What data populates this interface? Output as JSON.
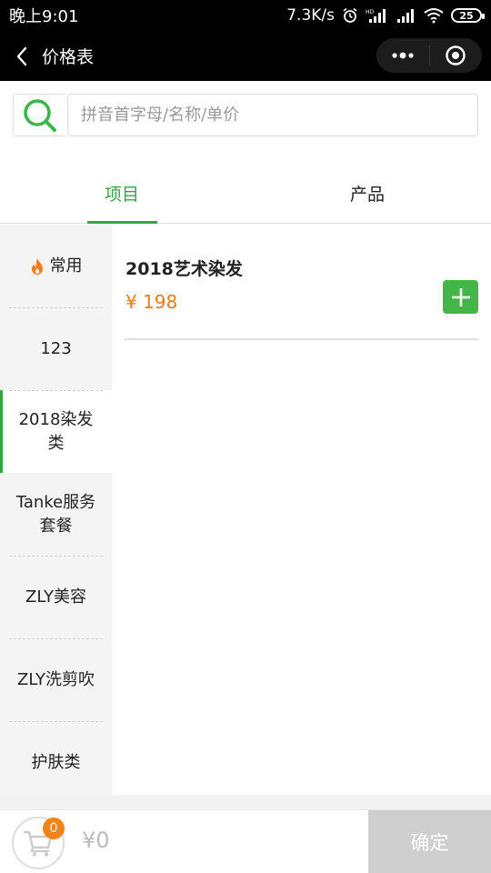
{
  "status_bar": {
    "time": "晚上9:01",
    "network_speed": "7.3K/s",
    "battery": "25",
    "hd_label": "HD"
  },
  "nav": {
    "title": "价格表"
  },
  "search": {
    "placeholder": "拼音首字母/名称/单价",
    "value": ""
  },
  "tabs": [
    {
      "label": "项目",
      "active": true
    },
    {
      "label": "产品",
      "active": false
    }
  ],
  "sidebar": {
    "items": [
      {
        "label": "常用",
        "icon": "fire-icon"
      },
      {
        "label": "123"
      },
      {
        "label": "2018染发类",
        "active": true
      },
      {
        "label": "Tanke服务套餐"
      },
      {
        "label": "ZLY美容"
      },
      {
        "label": "ZLY洗剪吹"
      },
      {
        "label": "护肤类"
      }
    ]
  },
  "products": [
    {
      "name": "2018艺术染发",
      "price": "¥ 198"
    }
  ],
  "cart": {
    "count": "0",
    "total": "¥0",
    "confirm_label": "确定"
  },
  "colors": {
    "accent": "#2fa843",
    "price": "#ee7a1a",
    "add_button": "#44b549",
    "badge": "#f08418",
    "confirm_bg": "#cfcfcf"
  }
}
